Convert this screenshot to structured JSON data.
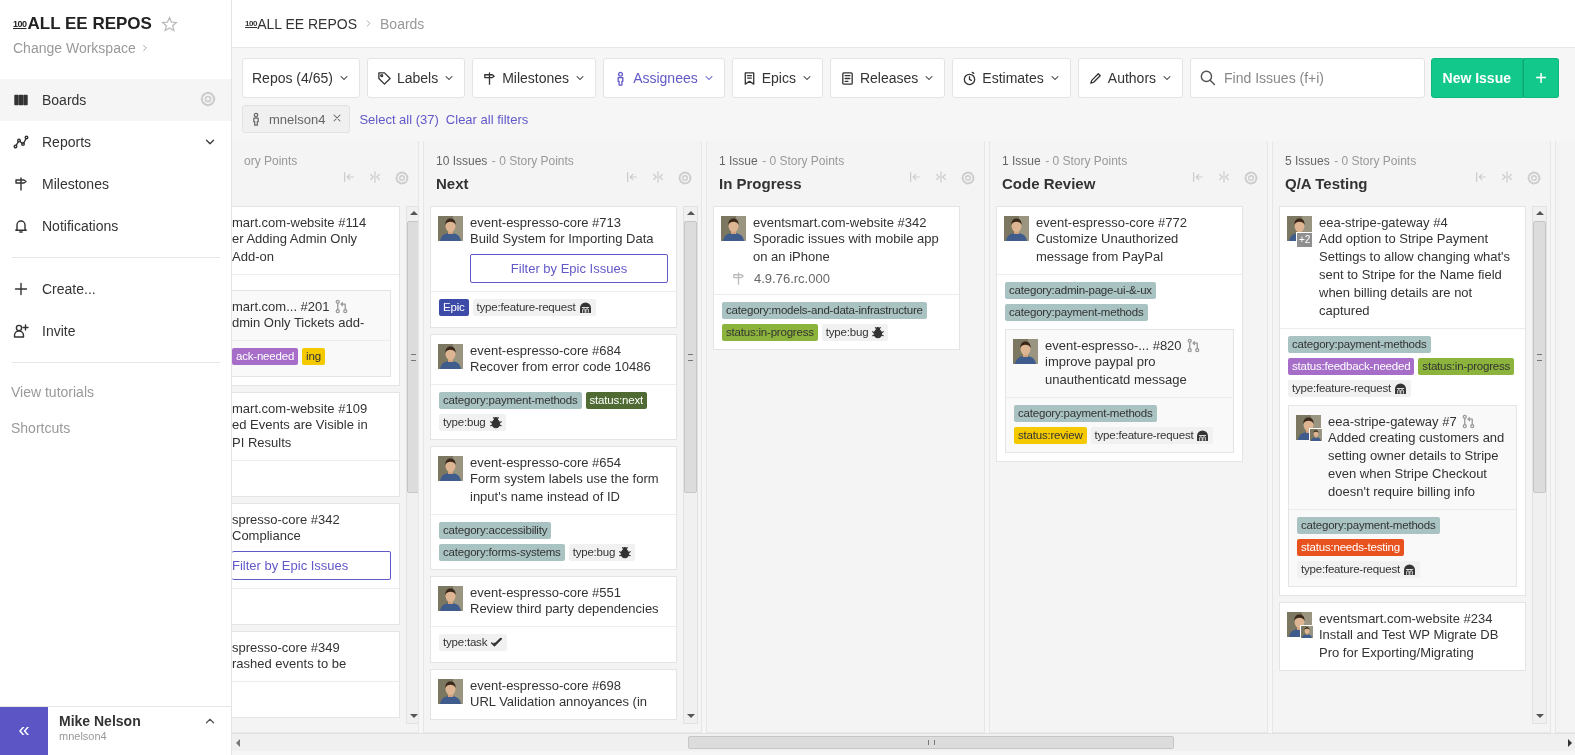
{
  "sidebar": {
    "workspace_icon": "100",
    "workspace": "ALL EE REPOS",
    "starred": false,
    "change_workspace": "Change Workspace",
    "nav": [
      {
        "label": "Boards",
        "selected": true
      },
      {
        "label": "Reports",
        "selected": false,
        "expanded": false
      },
      {
        "label": "Milestones",
        "selected": false
      },
      {
        "label": "Notifications",
        "selected": false
      }
    ],
    "actions": [
      "Create...",
      "Invite"
    ],
    "links": [
      "View tutorials",
      "Shortcuts"
    ],
    "collapse": "«",
    "user_name": "Mike Nelson",
    "username": "mnelson4"
  },
  "breadcrumb": {
    "icon": "100",
    "workspace": "ALL EE REPOS",
    "page": "Boards"
  },
  "toolbar": {
    "filters": [
      {
        "label": "Repos (4/65)",
        "active": false
      },
      {
        "label": "Labels",
        "active": false
      },
      {
        "label": "Milestones",
        "active": false
      },
      {
        "label": "Assignees",
        "active": true
      },
      {
        "label": "Epics",
        "active": false
      },
      {
        "label": "Releases",
        "active": false
      },
      {
        "label": "Estimates",
        "active": false
      },
      {
        "label": "Authors",
        "active": false
      }
    ],
    "search": {
      "placeholder": "Find Issues (f+i)"
    },
    "new_issue": "New Issue",
    "new_issue_menu": "+"
  },
  "active_filters": {
    "chips": [
      {
        "label": "mnelson4"
      }
    ],
    "links": [
      "Select all (37)",
      "Clear all filters"
    ]
  },
  "partial_column": {
    "points": "ory Points",
    "scrollable": true,
    "cards": [
      {
        "ref": "mart.com-website #114",
        "title": "er Adding Admin Only\nAdd-on",
        "children": [
          {
            "ref": "mart.com...  #201",
            "linked_pr": true,
            "title": "dmin Only Tickets add-",
            "labels": [
              {
                "text": "ack-needed",
                "color": "#a66dc9"
              },
              {
                "text": "ing",
                "color": "#f5c900"
              }
            ]
          }
        ]
      },
      {
        "ref": "mart.com-website #109",
        "title": "ed Events are Visible in\nPI Results"
      },
      {
        "ref": "spresso-core #342",
        "title": "Compliance",
        "epic_filter": "Filter by Epic Issues"
      },
      {
        "ref": "spresso-core #349",
        "title": "rashed events to be"
      }
    ]
  },
  "columns": [
    {
      "count": "10 Issues",
      "points": "- 0 Story Points",
      "title": "Next",
      "scrollable": true,
      "cards": [
        {
          "ref": "event-espresso-core #713",
          "title": "Build System for Importing Data",
          "epic_filter": "Filter by Epic Issues",
          "labels": [
            {
              "text": "Epic",
              "color": "#3c4ba8"
            },
            {
              "text": "type:feature-request",
              "color": "#f1f1f1",
              "kind": "feature"
            }
          ]
        },
        {
          "ref": "event-espresso-core #684",
          "title": "Recover from error code 10486",
          "labels": [
            {
              "text": "category:payment-methods",
              "color": "#a9c3c3"
            },
            {
              "text": "status:next",
              "color": "#4f6b33"
            },
            {
              "text": "type:bug",
              "color": "#f1f1f1",
              "kind": "bug"
            }
          ]
        },
        {
          "ref": "event-espresso-core #654",
          "title": "Form system labels use the form input's name instead of ID",
          "labels": [
            {
              "text": "category:accessibility",
              "color": "#a9c3c3"
            },
            {
              "text": "category:forms-systems",
              "color": "#a9c3c3"
            },
            {
              "text": "type:bug",
              "color": "#f1f1f1",
              "kind": "bug"
            }
          ]
        },
        {
          "ref": "event-espresso-core #551",
          "title": "Review third party dependencies",
          "labels": [
            {
              "text": "type:task",
              "color": "#f1f1f1",
              "kind": "task"
            }
          ]
        },
        {
          "ref": "event-espresso-core #698",
          "title": "URL Validation annoyances (in"
        }
      ]
    },
    {
      "count": "1 Issue",
      "points": "- 0 Story Points",
      "title": "In Progress",
      "scrollable": false,
      "cards": [
        {
          "ref": "eventsmart.com-website #342",
          "title": "Sporadic issues with mobile app on an iPhone",
          "milestone": "4.9.76.rc.000",
          "labels": [
            {
              "text": "category:models-and-data-infrastructure",
              "color": "#a9c3c3"
            },
            {
              "text": "status:in-progress",
              "color": "#8cb43c"
            },
            {
              "text": "type:bug",
              "color": "#f1f1f1",
              "kind": "bug"
            }
          ]
        }
      ]
    },
    {
      "count": "1 Issue",
      "points": "- 0 Story Points",
      "title": "Code Review",
      "scrollable": false,
      "cards": [
        {
          "ref": "event-espresso-core #772",
          "title": "Customize Unauthorized message from PayPal",
          "labels": [
            {
              "text": "category:admin-page-ui-&-ux",
              "color": "#a9c3c3"
            },
            {
              "text": "category:payment-methods",
              "color": "#a9c3c3"
            }
          ],
          "children": [
            {
              "ref": "event-espresso-... #820",
              "linked_pr": true,
              "title": "improve paypal pro unauthenticatd message",
              "labels": [
                {
                  "text": "category:payment-methods",
                  "color": "#a9c3c3"
                },
                {
                  "text": "status:review",
                  "color": "#f5c900"
                },
                {
                  "text": "type:feature-request",
                  "color": "#f1f1f1",
                  "kind": "feature"
                }
              ]
            }
          ]
        }
      ]
    },
    {
      "count": "5 Issues",
      "points": "- 0 Story Points",
      "title": "Q/A Testing",
      "scrollable": true,
      "cards": [
        {
          "ref": "eea-stripe-gateway #4",
          "assignee_badge": "+2",
          "title": "Add option to Stripe Payment Settings to allow changing what's sent to Stripe for the Name field when billing details are not captured",
          "labels": [
            {
              "text": "category:payment-methods",
              "color": "#a9c3c3"
            },
            {
              "text": "status:feedback-needed",
              "color": "#a66dc9"
            },
            {
              "text": "status:in-progress",
              "color": "#8cb43c"
            },
            {
              "text": "type:feature-request",
              "color": "#f1f1f1",
              "kind": "feature"
            }
          ],
          "children": [
            {
              "ref": "eea-stripe-gateway #7",
              "linked_pr": true,
              "second_assignee": true,
              "title": "Added creating customers and setting owner details to Stripe even when Stripe Checkout doesn't require billing info",
              "labels": [
                {
                  "text": "category:payment-methods",
                  "color": "#a9c3c3"
                },
                {
                  "text": "status:needs-testing",
                  "color": "#e8521f"
                },
                {
                  "text": "type:feature-request",
                  "color": "#f1f1f1",
                  "kind": "feature"
                }
              ]
            }
          ]
        },
        {
          "ref": "eventsmart.com-website #234",
          "second_assignee": true,
          "title": "Install and Test WP Migrate DB Pro for Exporting/Migrating"
        }
      ]
    }
  ]
}
